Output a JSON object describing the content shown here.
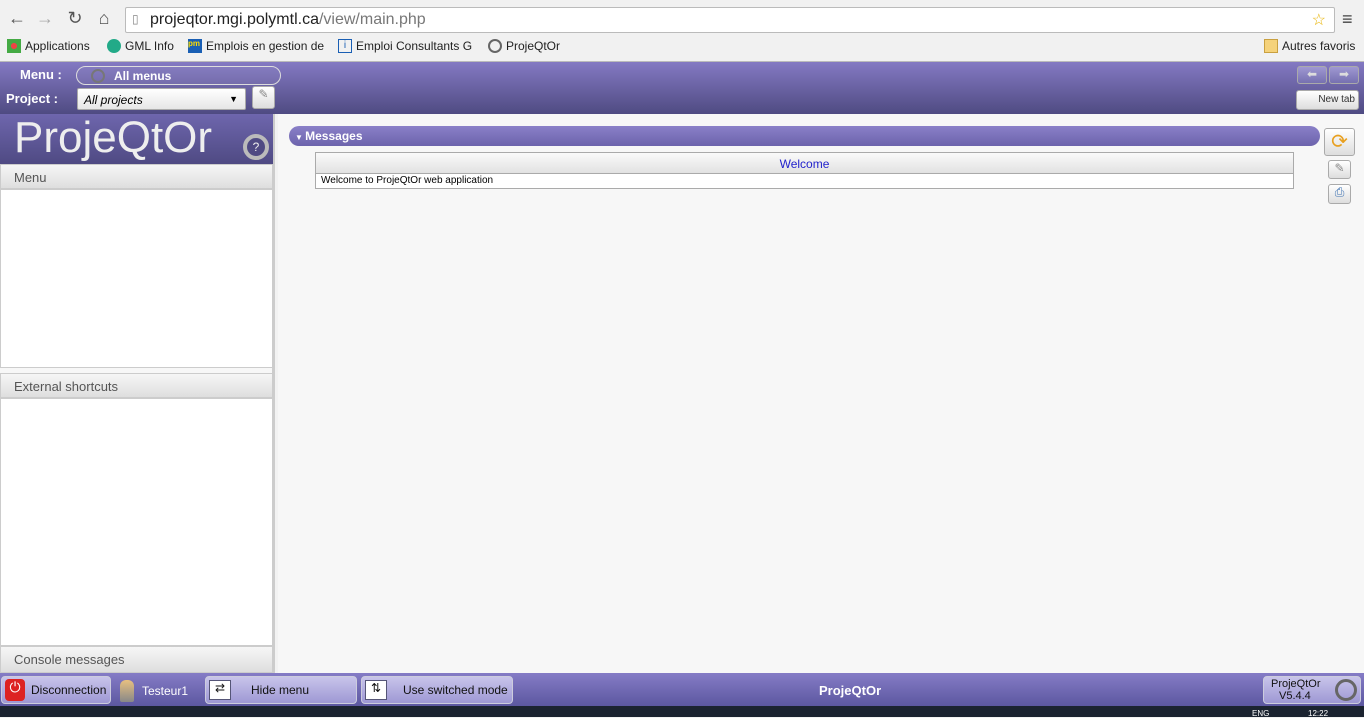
{
  "browser": {
    "url_host": "projeqtor.mgi.polymtl.ca",
    "url_path": "/view/main.php",
    "bookmarks": [
      "Applications",
      "GML Info",
      "Emplois en gestion de",
      "Emploi Consultants G",
      "ProjeQtOr"
    ],
    "other_bookmarks": "Autres favoris"
  },
  "topbar": {
    "menu_label": "Menu :",
    "menu_value": "All menus",
    "project_label": "Project :",
    "project_value": "All projects",
    "new_tab": "New tab"
  },
  "left": {
    "logo": "ProjeQtOr",
    "menu_title": "Menu",
    "shortcuts_title": "External shortcuts",
    "console_title": "Console messages"
  },
  "main": {
    "messages_title": "Messages",
    "table_header": "Welcome",
    "table_row": "Welcome to ProjeQtOr web application"
  },
  "bottom": {
    "disconnect": "Disconnection",
    "user": "Testeur1",
    "hide_menu": "Hide menu",
    "switched_mode": "Use switched mode",
    "app_name": "ProjeQtOr",
    "version_name": "ProjeQtOr",
    "version": "V5.4.4"
  },
  "taskbar": {
    "lang": "ENG",
    "time": "12:22"
  }
}
